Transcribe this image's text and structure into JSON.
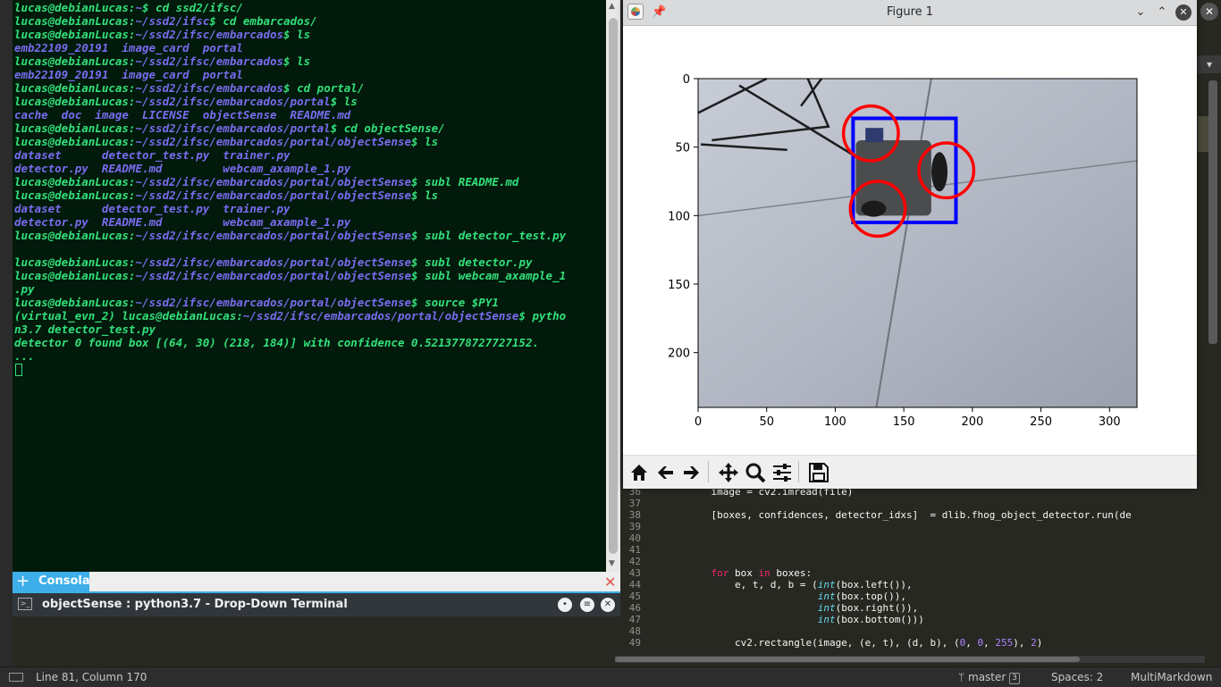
{
  "terminal": {
    "lines": [
      {
        "prompt": "lucas@debianLucas:",
        "path": "~",
        "rest": "$ cd ssd2/ifsc/"
      },
      {
        "prompt": "lucas@debianLucas:",
        "path": "~/ssd2/ifsc",
        "rest": "$ cd embarcados/"
      },
      {
        "prompt": "lucas@debianLucas:",
        "path": "~/ssd2/ifsc/embarcados",
        "rest": "$ ls"
      },
      {
        "out": "emb22109_20191  image_card  portal"
      },
      {
        "prompt": "lucas@debianLucas:",
        "path": "~/ssd2/ifsc/embarcados",
        "rest": "$ ls"
      },
      {
        "out": "emb22109_20191  image_card  portal"
      },
      {
        "prompt": "lucas@debianLucas:",
        "path": "~/ssd2/ifsc/embarcados",
        "rest": "$ cd portal/"
      },
      {
        "prompt": "lucas@debianLucas:",
        "path": "~/ssd2/ifsc/embarcados/portal",
        "rest": "$ ls"
      },
      {
        "out": "cache  doc  image  LICENSE  objectSense  README.md"
      },
      {
        "prompt": "lucas@debianLucas:",
        "path": "~/ssd2/ifsc/embarcados/portal",
        "rest": "$ cd objectSense/"
      },
      {
        "prompt": "lucas@debianLucas:",
        "path": "~/ssd2/ifsc/embarcados/portal/objectSense",
        "rest": "$ ls"
      },
      {
        "out": "dataset      detector_test.py  trainer.py"
      },
      {
        "out": "detector.py  README.md         webcam_axample_1.py"
      },
      {
        "prompt": "lucas@debianLucas:",
        "path": "~/ssd2/ifsc/embarcados/portal/objectSense",
        "rest": "$ subl README.md"
      },
      {
        "prompt": "lucas@debianLucas:",
        "path": "~/ssd2/ifsc/embarcados/portal/objectSense",
        "rest": "$ ls"
      },
      {
        "out": "dataset      detector_test.py  trainer.py"
      },
      {
        "out": "detector.py  README.md         webcam_axample_1.py"
      },
      {
        "prompt": "lucas@debianLucas:",
        "path": "~/ssd2/ifsc/embarcados/portal/objectSense",
        "rest": "$ subl detector_test.py"
      },
      {
        "blank": ""
      },
      {
        "prompt": "lucas@debianLucas:",
        "path": "~/ssd2/ifsc/embarcados/portal/objectSense",
        "rest": "$ subl detector.py"
      },
      {
        "prompt": "lucas@debianLucas:",
        "path": "~/ssd2/ifsc/embarcados/portal/objectSense",
        "rest": "$ subl webcam_axample_1"
      },
      {
        "green": ".py"
      },
      {
        "prompt": "lucas@debianLucas:",
        "path": "~/ssd2/ifsc/embarcados/portal/objectSense",
        "rest": "$ source $PY1"
      },
      {
        "prompt": "(virtual_evn_2) lucas@debianLucas:",
        "path": "~/ssd2/ifsc/embarcados/portal/objectSense",
        "rest": "$ pytho"
      },
      {
        "green": "n3.7 detector_test.py"
      },
      {
        "green": "detector 0 found box [(64, 30) (218, 184)] with confidence 0.5213778727727152."
      },
      {
        "green": "..."
      }
    ],
    "tab_label": "Consola",
    "title": "objectSense : python3.7 - Drop-Down Terminal"
  },
  "figure": {
    "title": "Figure 1",
    "detections": {
      "box": {
        "x0": 113,
        "y0": 29,
        "x1": 188,
        "y1": 105,
        "color": "#0000ff"
      },
      "circles": [
        {
          "cx": 126,
          "cy": 40,
          "r": 20
        },
        {
          "cx": 181,
          "cy": 67,
          "r": 20
        },
        {
          "cx": 131,
          "cy": 95,
          "r": 20
        }
      ],
      "circle_color": "#ff0000"
    }
  },
  "chart_data": {
    "type": "image",
    "xlim": [
      0,
      320
    ],
    "ylim": [
      240,
      0
    ],
    "xticks": [
      0,
      50,
      100,
      150,
      200,
      250,
      300
    ],
    "yticks": [
      0,
      50,
      100,
      150,
      200
    ]
  },
  "editor": {
    "code": [
      {
        "n": "36",
        "html": "    image = cv2.imread(file)"
      },
      {
        "n": "37",
        "html": ""
      },
      {
        "n": "38",
        "html": "    [boxes, confidences, detector_idxs]  = dlib.fhog_object_detector.run(de"
      },
      {
        "n": "39",
        "html": ""
      },
      {
        "n": "40",
        "html": ""
      },
      {
        "n": "41",
        "html": ""
      },
      {
        "n": "42",
        "html": ""
      },
      {
        "n": "43",
        "html": "    for box in boxes:"
      },
      {
        "n": "44",
        "html": "        e, t, d, b = (int(box.left()),"
      },
      {
        "n": "45",
        "html": "                      int(box.top()),"
      },
      {
        "n": "46",
        "html": "                      int(box.right()),"
      },
      {
        "n": "47",
        "html": "                      int(box.bottom()))"
      },
      {
        "n": "48",
        "html": ""
      },
      {
        "n": "49",
        "html": "        cv2.rectangle(image, (e, t), (d, b), (0, 0, 255), 2)"
      }
    ],
    "status": {
      "position": "Line 81, Column 170",
      "branch": "master",
      "branch_badge": "3",
      "spaces": "Spaces: 2",
      "syntax": "MultiMarkdown"
    }
  }
}
